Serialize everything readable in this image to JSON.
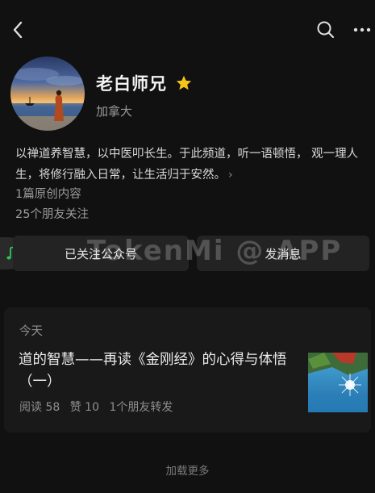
{
  "profile": {
    "name": "老白师兄",
    "location": "加拿大",
    "bio": "以禅道养智慧，以中医叩长生。于此频道，听一语顿悟， 观一理人生，将修行融入日常，让生活归于安然。",
    "original_count": "1篇原创内容",
    "friends_following": "25个朋友关注"
  },
  "actions": {
    "follow_label": "已关注公众号",
    "message_label": "发消息"
  },
  "watermark": "TokenMi @ APP",
  "article": {
    "date_label": "今天",
    "title": "道的智慧——再读《金刚经》的心得与体悟（一）",
    "reads": "阅读 58",
    "likes": "赞 10",
    "shares": "1个朋友转发"
  },
  "footer": {
    "load_more": "加载更多"
  },
  "icons": {
    "back": "chevron-left-icon",
    "search": "search-icon",
    "more": "more-dots-icon",
    "verified": "star-icon",
    "music": "music-note-icon"
  },
  "colors": {
    "background": "#111111",
    "card": "#191919",
    "button": "#232323",
    "star": "#f5c518",
    "music": "#2ec45a"
  }
}
